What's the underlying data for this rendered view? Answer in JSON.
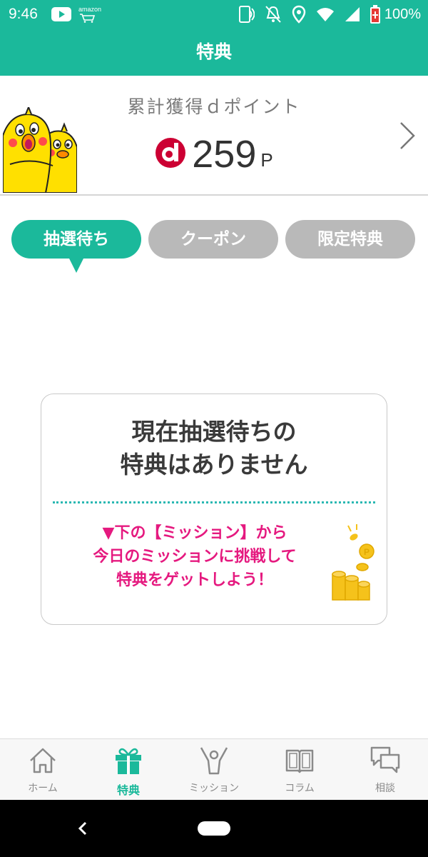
{
  "status_bar": {
    "time": "9:46",
    "amazon_label": "amazon",
    "battery": "100%",
    "icons": [
      "youtube-icon",
      "amazon-icon",
      "nfc-icon",
      "bell-off-icon",
      "location-icon",
      "wifi-icon",
      "signal-icon",
      "battery-icon"
    ]
  },
  "header": {
    "title": "特典"
  },
  "points": {
    "label": "累計獲得ｄポイント",
    "value": "259",
    "unit": "P"
  },
  "tabs": [
    {
      "label": "抽選待ち",
      "active": true
    },
    {
      "label": "クーポン",
      "active": false
    },
    {
      "label": "限定特典",
      "active": false
    }
  ],
  "empty_state": {
    "message_line1": "現在抽選待ちの",
    "message_line2": "特典はありません",
    "hint_line1": "▼下の【ミッション】から",
    "hint_line2": "今日のミッションに挑戦して",
    "hint_line3": "特典をゲットしよう！"
  },
  "bottom_nav": [
    {
      "label": "ホーム",
      "icon": "home-icon",
      "active": false
    },
    {
      "label": "特典",
      "icon": "gift-icon",
      "active": true
    },
    {
      "label": "ミッション",
      "icon": "mission-icon",
      "active": false
    },
    {
      "label": "コラム",
      "icon": "book-icon",
      "active": false
    },
    {
      "label": "相談",
      "icon": "chat-icon",
      "active": false
    }
  ],
  "colors": {
    "accent": "#1bb99b",
    "inactive_tab": "#b9b9b9",
    "hint": "#e5197f",
    "d_logo": "#cc0033"
  }
}
